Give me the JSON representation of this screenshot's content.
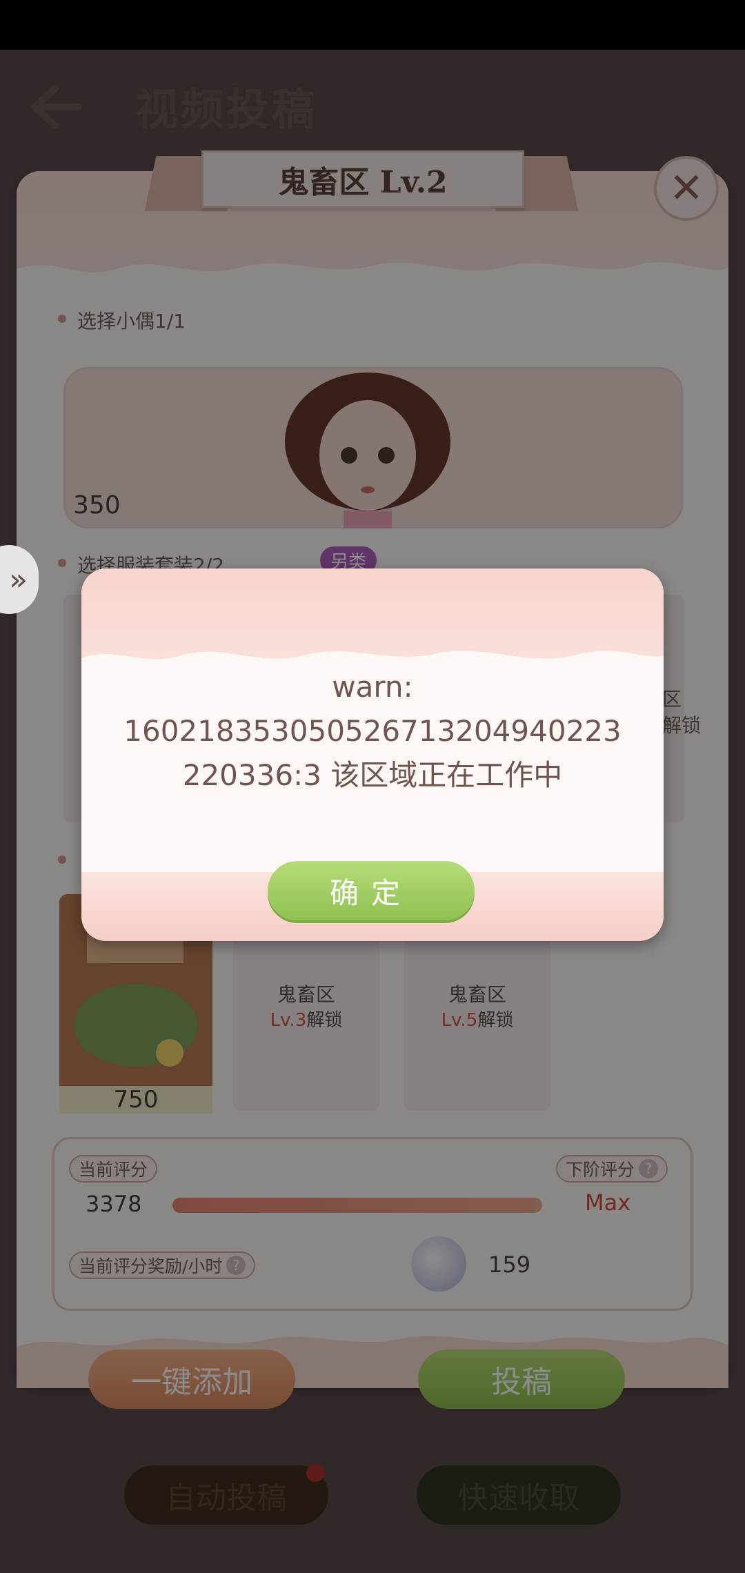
{
  "screen": {
    "title": "视频投稿"
  },
  "panel": {
    "ribbon_title": "鬼畜区 Lv.2",
    "select_doll_label": "选择小偶1/1",
    "doll_score": "350",
    "select_outfit_label": "选择服装套装2/2",
    "outfit_tag": "另类",
    "scene_card_value": "750",
    "locked_cards": [
      {
        "title": "鬼畜区",
        "level": "Lv.3",
        "suffix": "解锁"
      },
      {
        "title": "鬼畜区",
        "level": "Lv.5",
        "suffix": "解锁"
      }
    ],
    "side_locked_fragment": "区",
    "side_locked_fragment2": "解锁"
  },
  "stats": {
    "current_score_label": "当前评分",
    "current_score": "3378",
    "next_score_label": "下阶评分",
    "next_score": "Max",
    "reward_label": "当前评分奖励/小时",
    "reward_value": "159",
    "progress_fraction": 1.0
  },
  "buttons": {
    "add_all": "一键添加",
    "submit": "投稿",
    "auto_submit": "自动投稿",
    "quick_collect": "快速收取"
  },
  "dialog": {
    "message": "warn:\n16021835305052671320494022​3\n220336:3 该区域正在工作中",
    "ok_label": "确定"
  },
  "colors": {
    "accent_red": "#d14a3e",
    "button_green": "#8fc250",
    "button_orange": "#dc8a5f"
  }
}
